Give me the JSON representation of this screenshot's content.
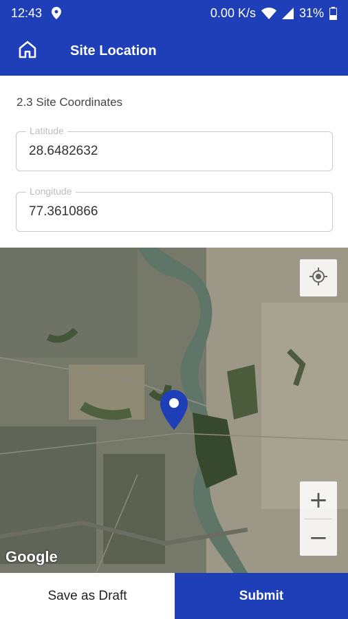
{
  "status_bar": {
    "time": "12:43",
    "network_speed": "0.00 K/s",
    "battery": "31%",
    "icons": [
      "location-icon",
      "wifi-icon",
      "signal-icon",
      "battery-icon"
    ]
  },
  "app_bar": {
    "title": "Site Location",
    "home_icon": "home-icon",
    "color": "#1f3fb8"
  },
  "form": {
    "section_title": "2.3 Site Coordinates",
    "latitude": {
      "label": "Latitude",
      "value": "28.6482632"
    },
    "longitude": {
      "label": "Longitude",
      "value": "77.3610866"
    }
  },
  "map": {
    "attribution": "Google",
    "controls": {
      "my_location_icon": "my-location-icon",
      "zoom_in": "+",
      "zoom_out": "−"
    },
    "marker_icon": "map-pin-icon"
  },
  "actions": {
    "save_draft": "Save as Draft",
    "submit": "Submit"
  }
}
